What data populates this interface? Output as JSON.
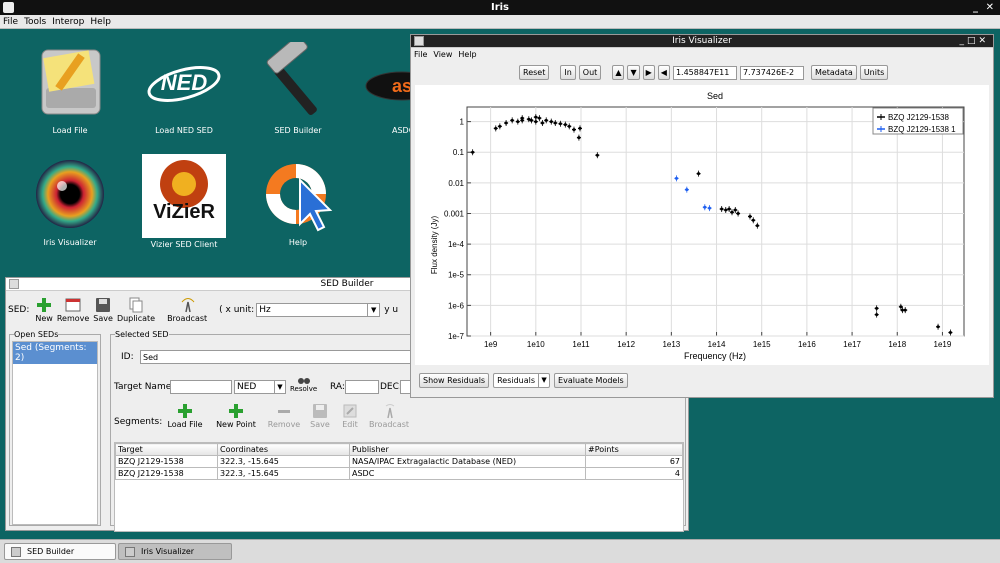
{
  "app": {
    "title": "Iris",
    "menu": [
      "File",
      "Tools",
      "Interop",
      "Help"
    ]
  },
  "desktop_icons": [
    {
      "id": "load-file",
      "label": "Load File"
    },
    {
      "id": "load-ned-sed",
      "label": "Load NED SED"
    },
    {
      "id": "sed-builder",
      "label": "SED Builder"
    },
    {
      "id": "asdc",
      "label": "ASDC"
    },
    {
      "id": "iris-visualizer",
      "label": "Iris Visualizer"
    },
    {
      "id": "vizier-sed-client",
      "label": "Vizier SED Client"
    },
    {
      "id": "help",
      "label": "Help"
    }
  ],
  "ned_logo": "NED",
  "vizier_logo": "ViZieR",
  "asdc_logo": "as",
  "sed_builder": {
    "title": "SED Builder",
    "sed_label": "SED:",
    "toolbar": [
      "New",
      "Remove",
      "Save",
      "Duplicate",
      "Broadcast"
    ],
    "x_unit_label": "( x unit:",
    "x_unit_value": "Hz",
    "y_unit_label": "y u",
    "open_seds_label": "Open SEDs",
    "open_seds_item": "Sed (Segments: 2)",
    "selected_sed_label": "Selected SED",
    "id_label": "ID:",
    "id_value": "Sed",
    "target_name_label": "Target Name:",
    "target_name_value": "",
    "resolver_value": "NED",
    "resolve_label": "Resolve",
    "ra_label": "RA:",
    "dec_label": "DEC:",
    "segments_label": "Segments:",
    "segment_buttons": [
      "Load File",
      "New Point",
      "Remove",
      "Save",
      "Edit",
      "Broadcast"
    ],
    "table_headers": [
      "Target",
      "Coordinates",
      "Publisher",
      "#Points"
    ],
    "table_rows": [
      [
        "BZQ J2129-1538",
        "322.3, -15.645",
        "NASA/IPAC Extragalactic Database (NED)",
        "67"
      ],
      [
        "BZQ J2129-1538",
        "322.3, -15.645",
        "ASDC",
        "4"
      ]
    ]
  },
  "visualizer": {
    "title": "Iris Visualizer",
    "menu": [
      "File",
      "View",
      "Help"
    ],
    "toolbar": {
      "reset": "Reset",
      "in": "In",
      "out": "Out",
      "x_value": "1.458847E11",
      "y_value": "7.737426E-2",
      "metadata": "Metadata",
      "units": "Units"
    },
    "bottom": {
      "show_residuals": "Show Residuals",
      "residuals_select": "Residuals",
      "evaluate": "Evaluate Models"
    }
  },
  "taskbar": [
    "SED Builder",
    "Iris Visualizer"
  ],
  "colors": {
    "desktop": "#0d6463",
    "series_ned": "#000000",
    "series_asdc": "#1e5ff0"
  },
  "chart_data": {
    "type": "scatter",
    "title": "Sed",
    "xlabel": "Frequency (Hz)",
    "ylabel": "Flux density (Jy)",
    "x_scale": "log",
    "y_scale": "log",
    "xlim": [
      300000000.0,
      3e+19
    ],
    "ylim": [
      1e-07,
      3
    ],
    "x_ticks": [
      "1e9",
      "1e10",
      "1e11",
      "1e12",
      "1e13",
      "1e14",
      "1e15",
      "1e16",
      "1e17",
      "1e18",
      "1e19"
    ],
    "y_ticks": [
      "1",
      "0.1",
      "0.01",
      "0.001",
      "1e-4",
      "1e-5",
      "1e-6",
      "1e-7"
    ],
    "legend_position": "top-right",
    "grid": true,
    "series": [
      {
        "name": "BZQ J2129-1538",
        "color": "#000000",
        "points": [
          [
            400000000.0,
            0.1
          ],
          [
            1300000000.0,
            0.6
          ],
          [
            1600000000.0,
            0.7
          ],
          [
            2200000000.0,
            0.9
          ],
          [
            3000000000.0,
            1.1
          ],
          [
            4000000000.0,
            1.0
          ],
          [
            5000000000.0,
            1.3
          ],
          [
            5000000000.0,
            1.1
          ],
          [
            7000000000.0,
            1.2
          ],
          [
            8000000000.0,
            1.1
          ],
          [
            10000000000.0,
            1.4
          ],
          [
            10000000000.0,
            1.0
          ],
          [
            12000000000.0,
            1.3
          ],
          [
            14000000000.0,
            0.9
          ],
          [
            17000000000.0,
            1.1
          ],
          [
            22000000000.0,
            1.0
          ],
          [
            27000000000.0,
            0.9
          ],
          [
            35000000000.0,
            0.85
          ],
          [
            45000000000.0,
            0.8
          ],
          [
            55000000000.0,
            0.7
          ],
          [
            70000000000.0,
            0.55
          ],
          [
            90000000000.0,
            0.3
          ],
          [
            95000000000.0,
            0.6
          ],
          [
            230000000000.0,
            0.08
          ],
          [
            40000000000000.0,
            0.02
          ],
          [
            130000000000000.0,
            0.0014
          ],
          [
            160000000000000.0,
            0.0013
          ],
          [
            190000000000000.0,
            0.0014
          ],
          [
            220000000000000.0,
            0.0011
          ],
          [
            260000000000000.0,
            0.0013
          ],
          [
            300000000000000.0,
            0.001
          ],
          [
            550000000000000.0,
            0.0008
          ],
          [
            650000000000000.0,
            0.0006
          ],
          [
            800000000000000.0,
            0.0004
          ],
          [
            3.5e+17,
            8e-07
          ],
          [
            3.5e+17,
            5e-07
          ],
          [
            1.2e+18,
            9e-07
          ],
          [
            1.3e+18,
            7e-07
          ],
          [
            1.5e+18,
            7e-07
          ],
          [
            8e+18,
            2e-07
          ],
          [
            1.5e+19,
            1.3e-07
          ]
        ]
      },
      {
        "name": "BZQ J2129-1538 1",
        "color": "#1e5ff0",
        "points": [
          [
            13000000000000.0,
            0.014
          ],
          [
            22000000000000.0,
            0.006
          ],
          [
            55000000000000.0,
            0.0016
          ],
          [
            70000000000000.0,
            0.0015
          ]
        ]
      }
    ]
  }
}
